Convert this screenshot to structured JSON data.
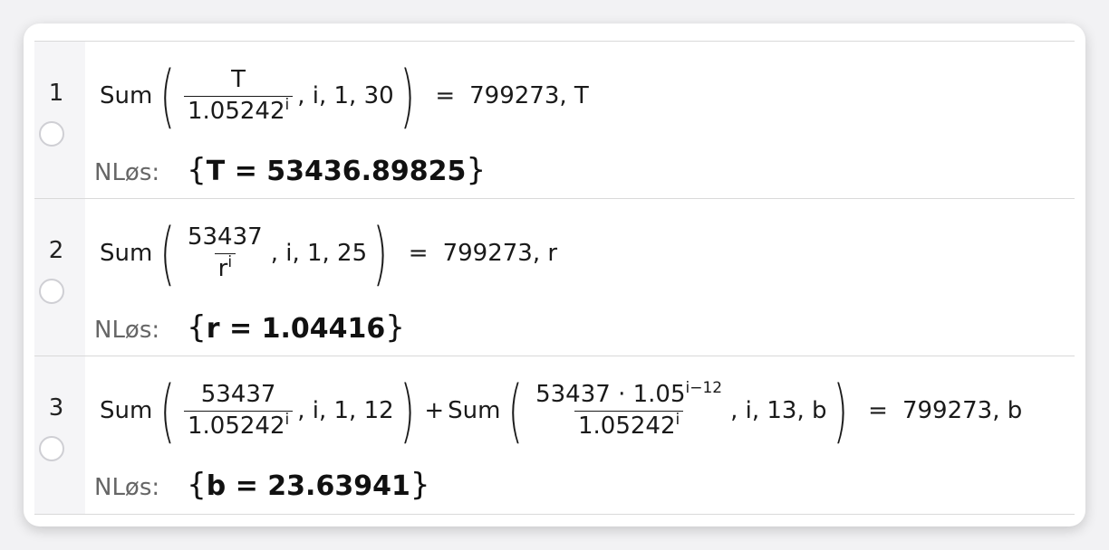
{
  "rows": [
    {
      "number": "1",
      "fn": "Sum",
      "terms": [
        {
          "fn": "Sum",
          "numerator": "T",
          "den_base": "1.05242",
          "den_exp": "i",
          "args": ", i, 1, 30"
        }
      ],
      "equals": "=",
      "rhs": "799273, T",
      "label": "NLøs:",
      "solution": "T = 53436.89825"
    },
    {
      "number": "2",
      "terms": [
        {
          "fn": "Sum",
          "numerator": "53437",
          "den_base": "r",
          "den_exp": "i",
          "args": ", i, 1, 25"
        }
      ],
      "equals": "=",
      "rhs": "799273, r",
      "label": "NLøs:",
      "solution": "r = 1.04416"
    },
    {
      "number": "3",
      "terms": [
        {
          "fn": "Sum",
          "numerator": "53437",
          "den_base": "1.05242",
          "den_exp": "i",
          "args": ", i, 1, 12"
        },
        {
          "fn": "Sum",
          "numerator": "53437 · 1.05",
          "num_exp": "i−12",
          "den_base": "1.05242",
          "den_exp": "i",
          "args": ", i, 13, b"
        }
      ],
      "plus": "+",
      "equals": "=",
      "rhs": "799273, b",
      "label": "NLøs:",
      "solution": "b = 23.63941"
    }
  ],
  "braces": {
    "open": "{",
    "close": "}"
  }
}
